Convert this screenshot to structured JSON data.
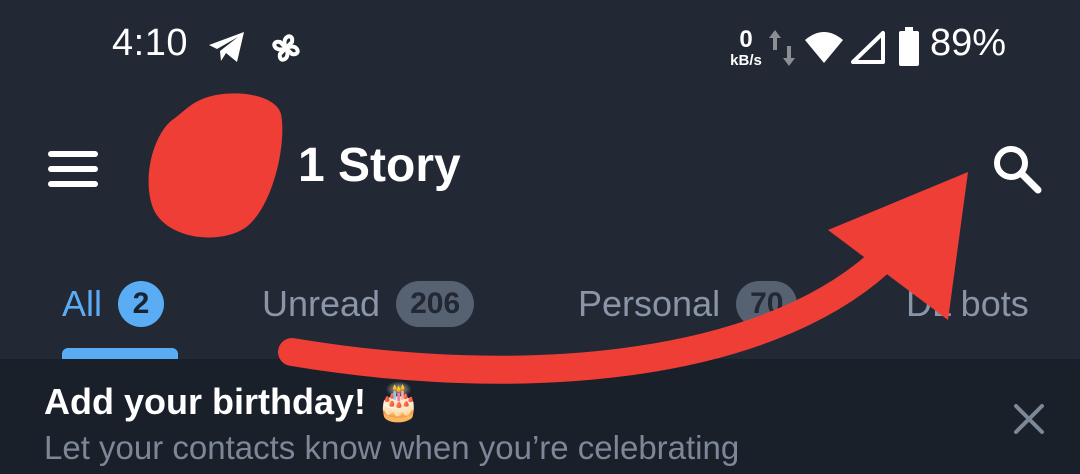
{
  "status_bar": {
    "time": "4:10",
    "net_speed_value": "0",
    "net_speed_unit": "kB/s",
    "battery": "89%",
    "icons": [
      "telegram-icon",
      "pinwheel-icon",
      "data-arrows-icon",
      "wifi-icon",
      "signal-icon",
      "battery-icon"
    ]
  },
  "header": {
    "title": "1 Story",
    "icons": [
      "menu-icon",
      "search-icon"
    ]
  },
  "tabs": [
    {
      "label": "All",
      "count": "2",
      "active": true
    },
    {
      "label": "Unread",
      "count": "206",
      "active": false
    },
    {
      "label": "Personal",
      "count": "70",
      "active": false
    },
    {
      "label": "DL bots",
      "active": false
    }
  ],
  "banner": {
    "title": "Add your birthday! 🎂",
    "subtitle": "Let your contacts know when you’re celebrating",
    "icons": [
      "close-icon"
    ]
  },
  "colors": {
    "background": "#222834",
    "banner_background": "#1a202a",
    "accent": "#5aacf5",
    "annotation_red": "#ef3e36"
  }
}
